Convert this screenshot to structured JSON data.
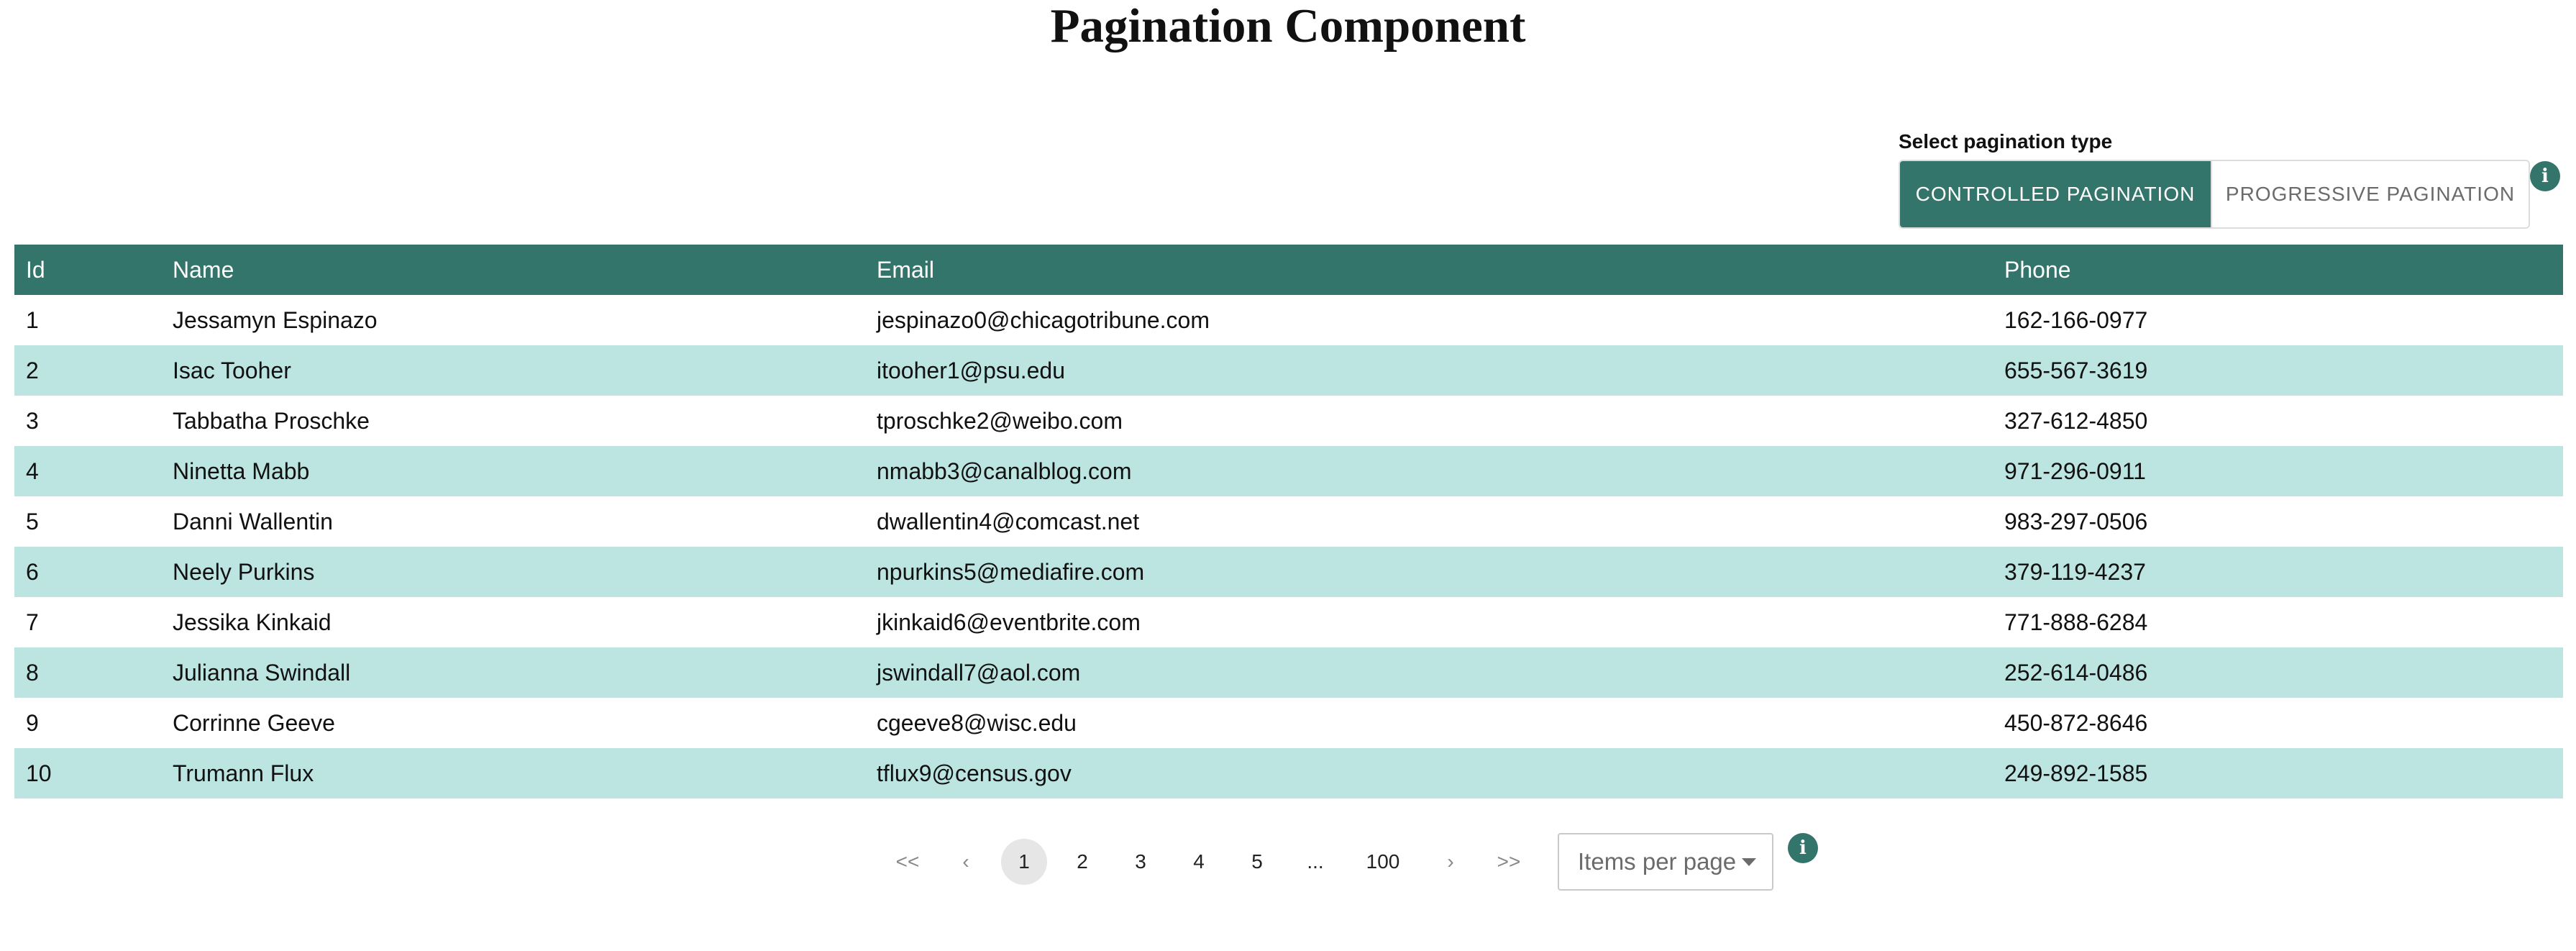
{
  "page": {
    "title": "Pagination Component"
  },
  "pagination_type": {
    "label": "Select pagination type",
    "options": [
      "CONTROLLED PAGINATION",
      "PROGRESSIVE PAGINATION"
    ],
    "selected": "CONTROLLED PAGINATION"
  },
  "table": {
    "columns": [
      "Id",
      "Name",
      "Email",
      "Phone"
    ],
    "rows": [
      [
        "1",
        "Jessamyn Espinazo",
        "jespinazo0@chicagotribune.com",
        "162-166-0977"
      ],
      [
        "2",
        "Isac Tooher",
        "itooher1@psu.edu",
        "655-567-3619"
      ],
      [
        "3",
        "Tabbatha Proschke",
        "tproschke2@weibo.com",
        "327-612-4850"
      ],
      [
        "4",
        "Ninetta Mabb",
        "nmabb3@canalblog.com",
        "971-296-0911"
      ],
      [
        "5",
        "Danni Wallentin",
        "dwallentin4@comcast.net",
        "983-297-0506"
      ],
      [
        "6",
        "Neely Purkins",
        "npurkins5@mediafire.com",
        "379-119-4237"
      ],
      [
        "7",
        "Jessika Kinkaid",
        "jkinkaid6@eventbrite.com",
        "771-888-6284"
      ],
      [
        "8",
        "Julianna Swindall",
        "jswindall7@aol.com",
        "252-614-0486"
      ],
      [
        "9",
        "Corrinne Geeve",
        "cgeeve8@wisc.edu",
        "450-872-8646"
      ],
      [
        "10",
        "Trumann Flux",
        "tflux9@census.gov",
        "249-892-1585"
      ]
    ]
  },
  "pager": {
    "first": "<<",
    "prev": "‹",
    "pages": [
      "1",
      "2",
      "3",
      "4",
      "5"
    ],
    "ellipsis": "...",
    "last_page": "100",
    "next": "›",
    "last": ">>",
    "current": "1",
    "items_per_page_placeholder": "Items per page"
  },
  "icons": {
    "info": "i"
  },
  "colors": {
    "accent": "#34756b",
    "row_alt": "#bce5e1"
  }
}
